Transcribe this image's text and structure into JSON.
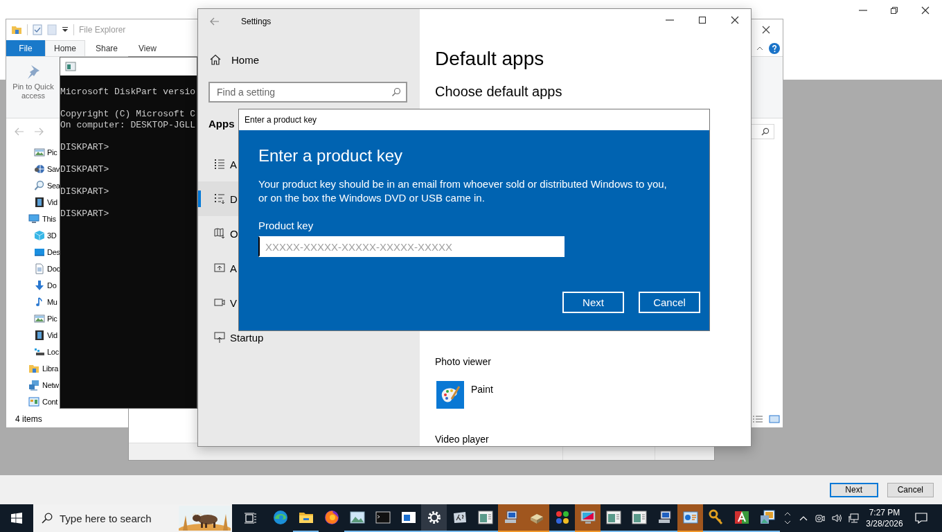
{
  "background_dialog": {
    "buttons": [
      {
        "label": "Next",
        "default": true
      },
      {
        "label": "Cancel",
        "default": false
      }
    ]
  },
  "file_explorer": {
    "title": "File Explorer",
    "ribbon_tabs": [
      {
        "label": "File",
        "kind": "menu",
        "selected": false
      },
      {
        "label": "Home",
        "kind": "tab",
        "selected": true
      },
      {
        "label": "Share",
        "kind": "tab",
        "selected": false
      },
      {
        "label": "View",
        "kind": "tab",
        "selected": false
      }
    ],
    "ribbon_command": "Pin to Quick access",
    "quick_access": [
      {
        "label": "Pic"
      },
      {
        "label": "Sav"
      },
      {
        "label": "Sea"
      },
      {
        "label": "Vid"
      }
    ],
    "tree": [
      {
        "label": "This",
        "children": [
          {
            "label": "3D"
          },
          {
            "label": "Des"
          },
          {
            "label": "Doc"
          },
          {
            "label": "Do"
          },
          {
            "label": "Mu"
          },
          {
            "label": "Pic"
          },
          {
            "label": "Vid"
          },
          {
            "label": "Loc"
          }
        ]
      },
      {
        "label": "Libra"
      },
      {
        "label": "Netw"
      },
      {
        "label": "Cont"
      }
    ],
    "status": "4 items"
  },
  "console": {
    "paragraphs": [
      [
        "Microsoft DiskPart versio"
      ],
      [
        "Copyright (C) Microsoft C",
        "On computer: DESKTOP-JGLL"
      ],
      [
        "DISKPART>"
      ],
      [
        "DISKPART>"
      ],
      [
        "DISKPART>"
      ],
      [
        "DISKPART>"
      ]
    ]
  },
  "settings": {
    "title": "Settings",
    "home": "Home",
    "search_placeholder": "Find a setting",
    "section": "Apps",
    "nav": [
      {
        "label": "A",
        "selected": false
      },
      {
        "label": "D",
        "selected": true
      },
      {
        "label": "O",
        "selected": false
      },
      {
        "label": "A",
        "selected": false
      },
      {
        "label": "V",
        "selected": false
      },
      {
        "label": "Startup",
        "selected": false
      }
    ],
    "heading": "Default apps",
    "subheading": "Choose default apps",
    "defaults": [
      {
        "category": "Photo viewer",
        "app": "Paint"
      },
      {
        "category": "Video player"
      }
    ]
  },
  "dialog": {
    "title": "Enter a product key",
    "heading": "Enter a product key",
    "message": "Your product key should be in an email from whoever sold or distributed Windows to you, or on the box the Windows DVD or USB came in.",
    "field_label": "Product key",
    "placeholder": "XXXXX-XXXXX-XXXXX-XXXXX-XXXXX",
    "buttons": [
      "Next",
      "Cancel"
    ]
  },
  "taskbar": {
    "search_placeholder": "Type here to search",
    "apps": [
      {
        "running": false,
        "active": false,
        "flashing": false
      },
      {
        "running": true,
        "active": false,
        "flashing": false
      },
      {
        "running": false,
        "active": false,
        "flashing": false
      },
      {
        "running": true,
        "active": false,
        "flashing": false
      },
      {
        "running": true,
        "active": false,
        "flashing": false
      },
      {
        "running": true,
        "active": false,
        "flashing": false
      },
      {
        "running": true,
        "active": true,
        "flashing": false
      },
      {
        "running": true,
        "active": false,
        "flashing": false
      },
      {
        "running": true,
        "active": false,
        "flashing": false
      },
      {
        "running": true,
        "active": false,
        "flashing": true
      },
      {
        "running": true,
        "active": false,
        "flashing": true
      },
      {
        "running": true,
        "active": false,
        "flashing": false
      },
      {
        "running": true,
        "active": false,
        "flashing": true
      },
      {
        "running": true,
        "active": false,
        "flashing": false
      },
      {
        "running": true,
        "active": false,
        "flashing": false
      },
      {
        "running": true,
        "active": false,
        "flashing": false
      },
      {
        "running": true,
        "active": false,
        "flashing": true
      },
      {
        "running": true,
        "active": false,
        "flashing": false
      },
      {
        "running": true,
        "active": false,
        "flashing": false
      },
      {
        "running": true,
        "active": false,
        "flashing": false
      }
    ],
    "time": "7:27 PM",
    "date": "3/28/2026"
  }
}
